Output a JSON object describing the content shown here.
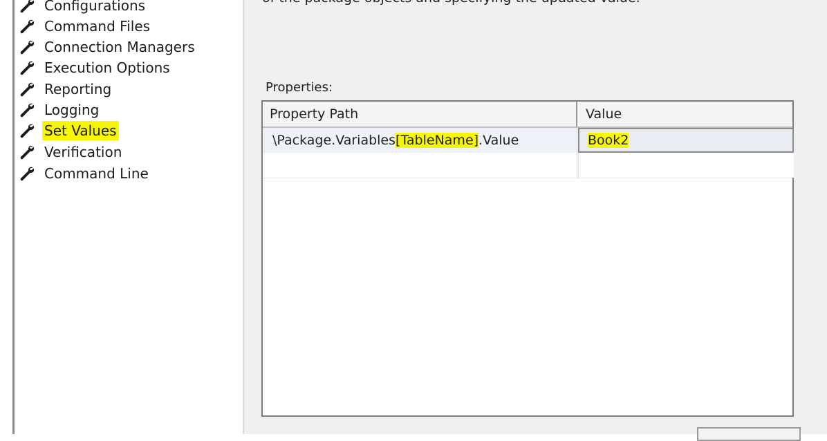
{
  "sidebar": {
    "items": [
      {
        "label": "Configurations",
        "selected": false,
        "icon": "wrench-icon"
      },
      {
        "label": "Command Files",
        "selected": false,
        "icon": "wrench-icon"
      },
      {
        "label": "Connection Managers",
        "selected": false,
        "icon": "wrench-icon"
      },
      {
        "label": "Execution Options",
        "selected": false,
        "icon": "wrench-icon"
      },
      {
        "label": "Reporting",
        "selected": false,
        "icon": "wrench-icon"
      },
      {
        "label": "Logging",
        "selected": false,
        "icon": "wrench-icon"
      },
      {
        "label": "Set Values",
        "selected": true,
        "icon": "wrench-icon"
      },
      {
        "label": "Verification",
        "selected": false,
        "icon": "wrench-icon"
      },
      {
        "label": "Command Line",
        "selected": false,
        "icon": "wrench-icon"
      }
    ]
  },
  "main": {
    "description": "of the package objects and specifying the updated value.",
    "properties_label": "Properties:",
    "grid": {
      "columns": [
        "Property Path",
        "Value"
      ],
      "rows": [
        {
          "path_prefix": "\\Package.Variables",
          "path_highlight": "[TableName]",
          "path_suffix": ".Value",
          "value": "Book2"
        }
      ]
    }
  },
  "colors": {
    "highlight": "#f7f700",
    "panel_background": "#f0f0f0"
  }
}
